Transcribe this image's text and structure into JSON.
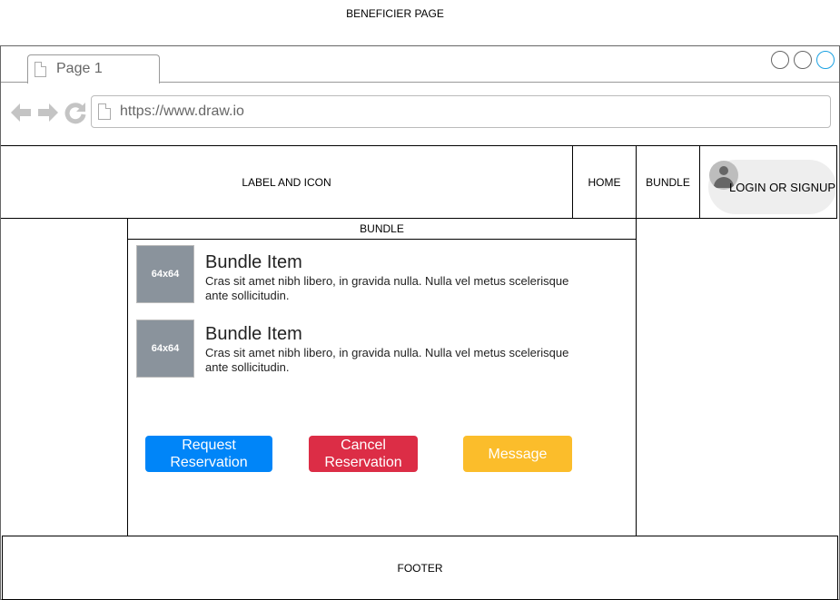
{
  "page_title": "BENEFICIER PAGE",
  "browser": {
    "tab_label": "Page 1",
    "url": "https://www.draw.io"
  },
  "header": {
    "brand": "LABEL AND ICON",
    "nav": [
      {
        "label": "HOME"
      },
      {
        "label": "BUNDLE"
      }
    ],
    "login_label": "LOGIN OR SIGNUP"
  },
  "bundle": {
    "title": "BUNDLE",
    "items": [
      {
        "thumb": "64x64",
        "title": "Bundle Item",
        "desc": "Cras sit amet nibh libero, in gravida nulla. Nulla vel metus scelerisque ante sollicitudin."
      },
      {
        "thumb": "64x64",
        "title": "Bundle Item",
        "desc": "Cras sit amet nibh libero, in gravida nulla. Nulla vel metus scelerisque ante sollicitudin."
      }
    ],
    "actions": {
      "request": {
        "label": "Request Reservation",
        "color": "#0085f8"
      },
      "cancel": {
        "label": "Cancel Reservation",
        "color": "#dc2d46"
      },
      "message": {
        "label": "Message",
        "color": "#fbbd2b"
      }
    }
  },
  "footer": "FOOTER",
  "icons": {
    "back": "back-arrow-icon",
    "forward": "forward-arrow-icon",
    "reload": "reload-icon",
    "page": "page-icon",
    "user": "user-icon"
  },
  "colors": {
    "thumb_bg": "#8a939c",
    "login_pill": "#eeeeee",
    "active_window_circle": "#1ba1e2"
  }
}
